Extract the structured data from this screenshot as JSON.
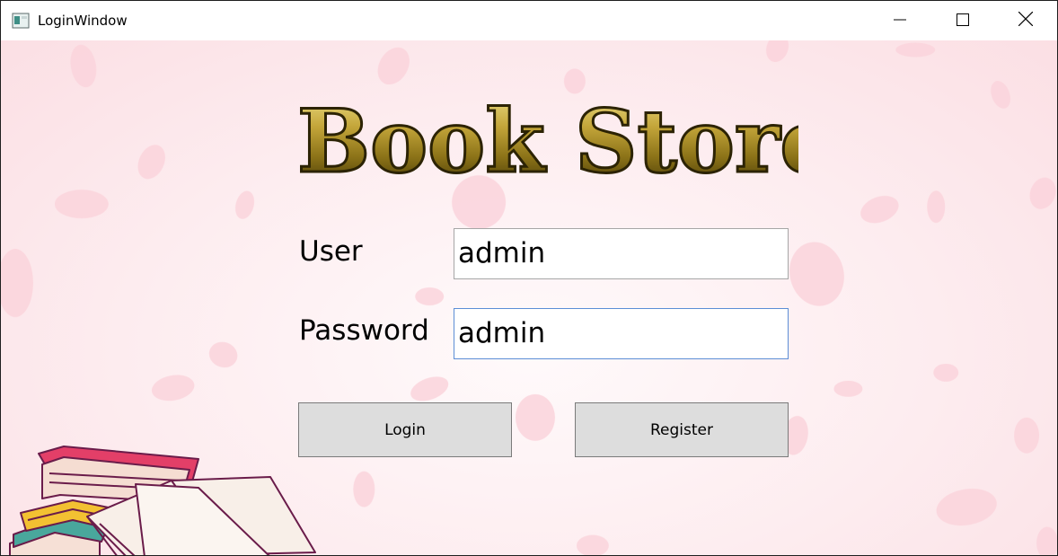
{
  "window": {
    "title": "LoginWindow",
    "icon": "app-window-icon",
    "controls": [
      "minimize-icon",
      "maximize-icon",
      "close-icon"
    ]
  },
  "app": {
    "heading": "Book Store"
  },
  "form": {
    "user_label": "User",
    "user_value": "admin",
    "password_label": "Password",
    "password_value": "admin",
    "login_label": "Login",
    "register_label": "Register"
  },
  "colors": {
    "background": "#fdecef",
    "heading_gold": "#b89a2a",
    "button_bg": "#dddddd",
    "focus_border": "#5c8ed6"
  }
}
